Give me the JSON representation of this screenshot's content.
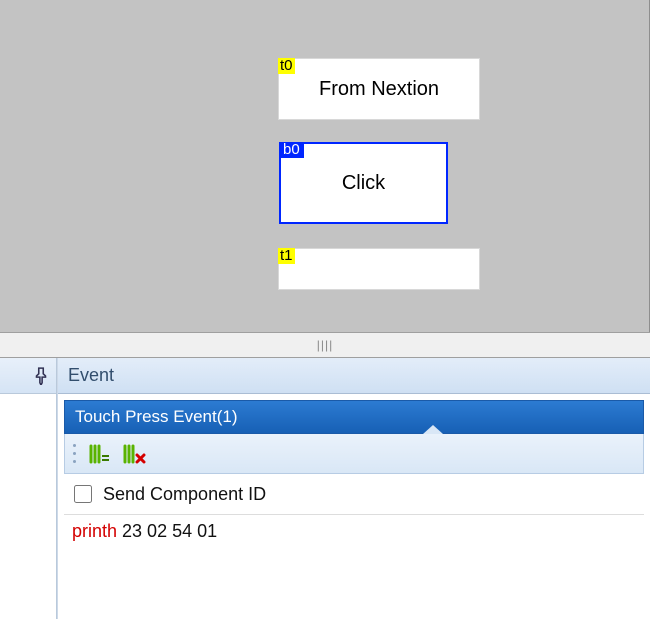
{
  "canvas": {
    "components": {
      "t0": {
        "tag": "t0",
        "text": "From Nextion"
      },
      "b0": {
        "tag": "b0",
        "text": "Click"
      },
      "t1": {
        "tag": "t1",
        "text": ""
      }
    }
  },
  "panel": {
    "title": "Event",
    "section_label": "Touch Press Event(1)",
    "send_component_id_label": "Send Component ID",
    "code": {
      "keyword": "printh",
      "args": " 23 02 54 01"
    }
  }
}
